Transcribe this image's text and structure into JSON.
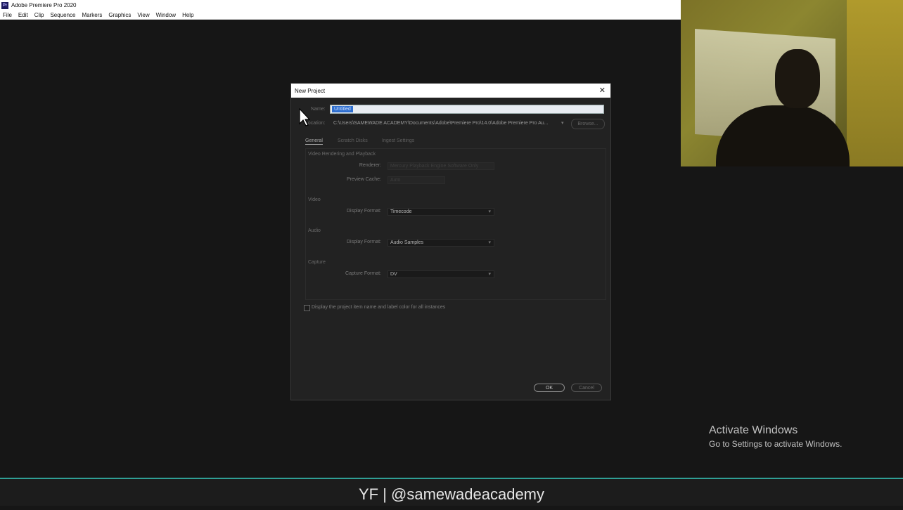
{
  "app": {
    "logo_text": "Pr",
    "title": "Adobe Premiere Pro 2020",
    "menu": [
      "File",
      "Edit",
      "Clip",
      "Sequence",
      "Markers",
      "Graphics",
      "View",
      "Window",
      "Help"
    ]
  },
  "dialog": {
    "title": "New Project",
    "close_symbol": "✕",
    "name_label": "Name:",
    "name_value": "Untitled",
    "location_label": "Location:",
    "location_path": "C:\\Users\\SAMEWADE ACADEMY\\Documents\\Adobe\\Premiere Pro\\14.0\\Adobe Premiere Pro Au...",
    "browse_label": "Browse...",
    "tabs": [
      "General",
      "Scratch Disks",
      "Ingest Settings"
    ],
    "vrp": {
      "section": "Video Rendering and Playback",
      "renderer_label": "Renderer:",
      "renderer_value": "Mercury Playback Engine Software Only",
      "preview_cache_label": "Preview Cache:",
      "preview_cache_value": "Auto"
    },
    "video": {
      "section": "Video",
      "display_format_label": "Display Format:",
      "display_format_value": "Timecode"
    },
    "audio": {
      "section": "Audio",
      "display_format_label": "Display Format:",
      "display_format_value": "Audio Samples"
    },
    "capture": {
      "section": "Capture",
      "capture_format_label": "Capture Format:",
      "capture_format_value": "DV"
    },
    "show_checkbox_label": "Display the project item name and label color for all instances",
    "show_checkbox_checked": false,
    "ok_label": "OK",
    "cancel_label": "Cancel"
  },
  "watermark": {
    "title": "Activate Windows",
    "subtitle": "Go to Settings to activate Windows."
  },
  "caption": "YF | @samewadeacademy",
  "colors": {
    "accent_line": "#2f9f95",
    "selection": "#2f6fcf"
  }
}
